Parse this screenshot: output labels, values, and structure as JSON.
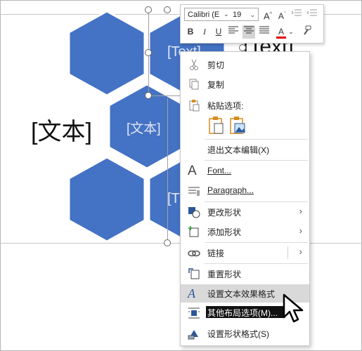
{
  "slide": {
    "text_left": "[文本]",
    "text_top_right": "[Text]",
    "hex_labels": {
      "top": "[Text]",
      "middle": "[文本]",
      "bottom": "[T"
    }
  },
  "mini_toolbar": {
    "font_name": "Calibri (E",
    "font_size": "19",
    "grow_font": "A",
    "shrink_font": "A",
    "bold": "B",
    "italic": "I",
    "underline": "U",
    "font_color": "A",
    "font_color_value": "#e00000"
  },
  "context_menu": {
    "cut": "剪切",
    "copy": "复制",
    "paste_options": "粘贴选项:",
    "exit_edit": "退出文本编辑(X)",
    "font": "Font...",
    "paragraph": "Paragraph...",
    "change_shape": "更改形状",
    "add_shape": "添加形状",
    "link": "链接",
    "reset_shape": "重置形状",
    "format_text_effects": "设置文本效果格式",
    "more_layout_options": "其他布局选项(M)...",
    "format_shape": "设置形状格式(S)"
  },
  "colors": {
    "hexagon_fill": "#4472c4",
    "menu_hover": "#d9d9d9",
    "icon_accent": "#2b579a",
    "paste_icon": "#d98c1d"
  }
}
